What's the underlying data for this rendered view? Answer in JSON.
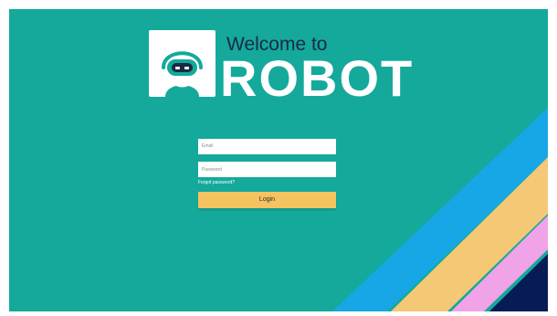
{
  "app": {
    "welcome_text": "Welcome to",
    "brand_name": "ROBOT"
  },
  "login": {
    "email_placeholder": "Email",
    "password_placeholder": "Password",
    "forgot_password": "Forgot password?",
    "login_label": "Login"
  },
  "colors": {
    "background_teal": "#14a99b",
    "stripe_blue": "#17a7e6",
    "stripe_yellow": "#f4c874",
    "stripe_pink": "#f0a3e7",
    "stripe_navy": "#071c57",
    "button_yellow": "#f5c35f"
  }
}
